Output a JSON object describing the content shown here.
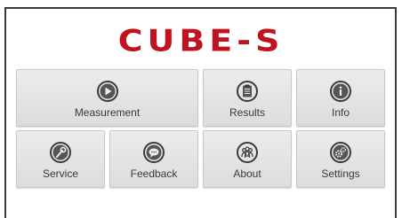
{
  "app": {
    "logo_text": "CUBE-S",
    "brand_color": "#c0121f"
  },
  "menu": {
    "measurement": {
      "label": "Measurement",
      "icon": "play-circle-icon"
    },
    "results": {
      "label": "Results",
      "icon": "clipboard-icon"
    },
    "info": {
      "label": "Info",
      "icon": "info-icon"
    },
    "service": {
      "label": "Service",
      "icon": "wrench-icon"
    },
    "feedback": {
      "label": "Feedback",
      "icon": "speech-bubble-icon"
    },
    "about": {
      "label": "About",
      "icon": "people-icon"
    },
    "settings": {
      "label": "Settings",
      "icon": "gears-icon"
    }
  }
}
